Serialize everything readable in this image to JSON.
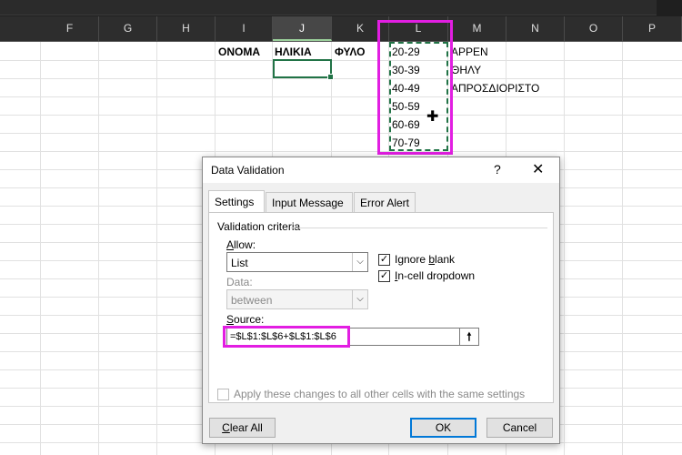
{
  "columns": [
    "F",
    "G",
    "H",
    "I",
    "J",
    "K",
    "L",
    "M",
    "N",
    "O",
    "P"
  ],
  "selected_column": "J",
  "sheet": {
    "headers": {
      "name": "ΟΝΟΜΑ",
      "age": "ΗΛΙΚΙΑ",
      "gender": "ΦΥΛΟ"
    },
    "age_ranges": [
      "20-29",
      "30-39",
      "40-49",
      "50-59",
      "60-69",
      "70-79"
    ],
    "genders": [
      "ΑΡΡΕΝ",
      "ΘΗΛΥ",
      "ΑΠΡΟΣΔΙΟΡΙΣΤΟ"
    ]
  },
  "dialog": {
    "title": "Data Validation",
    "help_glyph": "?",
    "close_glyph": "✕",
    "tabs": {
      "settings": "Settings",
      "input_message": "Input Message",
      "error_alert": "Error Alert"
    },
    "active_tab": "Settings",
    "criteria_legend": "Validation criteria",
    "allow": {
      "label": "Allow:",
      "value": "List"
    },
    "data": {
      "label": "Data:",
      "value": "between"
    },
    "ignore_blank": {
      "label": "Ignore blank",
      "checked": true
    },
    "in_cell_dropdown": {
      "label": "In-cell dropdown",
      "checked": true
    },
    "source": {
      "label": "Source:",
      "value": "=$L$1:$L$6+$L$1:$L$6"
    },
    "apply_all": {
      "label": "Apply these changes to all other cells with the same settings",
      "checked": false
    },
    "buttons": {
      "clear_all": "Clear All",
      "ok": "OK",
      "cancel": "Cancel"
    }
  },
  "colors": {
    "accent": "#217346",
    "highlight": "#e21ee2",
    "ok_border": "#0078d7"
  },
  "icons": {
    "cursor": "plus-cursor-icon",
    "collapse": "collapse-dialog-icon",
    "dropdown": "chevron-down-icon"
  }
}
